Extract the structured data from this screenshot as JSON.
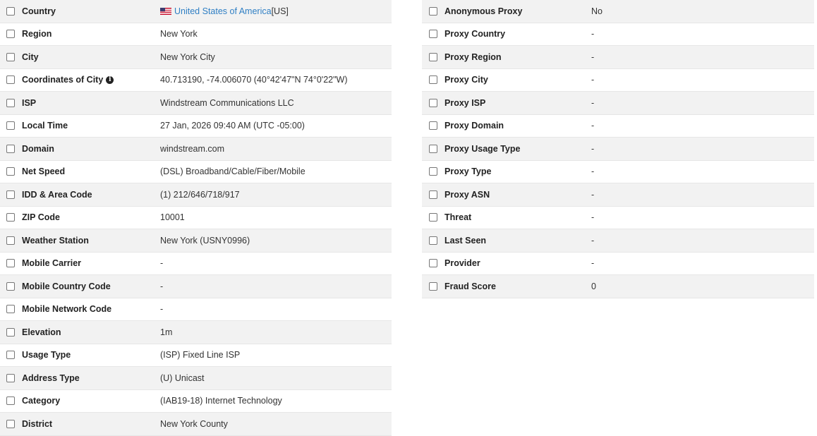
{
  "left": [
    {
      "key": "country",
      "label": "Country",
      "value": "United States of America",
      "suffix": " [US]",
      "flag": "us-flag-icon"
    },
    {
      "key": "region",
      "label": "Region",
      "value": "New York"
    },
    {
      "key": "city",
      "label": "City",
      "value": "New York City"
    },
    {
      "key": "coordinates",
      "label": "Coordinates of City",
      "value": "40.713190, -74.006070 (40°42'47\"N   74°0'22\"W)",
      "info": "info-icon"
    },
    {
      "key": "isp",
      "label": "ISP",
      "value": "Windstream Communications LLC"
    },
    {
      "key": "local-time",
      "label": "Local Time",
      "value": "27 Jan, 2026 09:40 AM (UTC -05:00)"
    },
    {
      "key": "domain",
      "label": "Domain",
      "value": "windstream.com"
    },
    {
      "key": "net-speed",
      "label": "Net Speed",
      "value": "(DSL) Broadband/Cable/Fiber/Mobile"
    },
    {
      "key": "idd-area-code",
      "label": "IDD & Area Code",
      "value": "(1) 212/646/718/917"
    },
    {
      "key": "zip-code",
      "label": "ZIP Code",
      "value": "10001"
    },
    {
      "key": "weather-station",
      "label": "Weather Station",
      "value": "New York (USNY0996)"
    },
    {
      "key": "mobile-carrier",
      "label": "Mobile Carrier",
      "value": "-"
    },
    {
      "key": "mobile-country-code",
      "label": "Mobile Country Code",
      "value": "-"
    },
    {
      "key": "mobile-network-code",
      "label": "Mobile Network Code",
      "value": "-"
    },
    {
      "key": "elevation",
      "label": "Elevation",
      "value": "1m"
    },
    {
      "key": "usage-type",
      "label": "Usage Type",
      "value": "(ISP) Fixed Line ISP"
    },
    {
      "key": "address-type",
      "label": "Address Type",
      "value": "(U) Unicast"
    },
    {
      "key": "category",
      "label": "Category",
      "value": "(IAB19-18) Internet Technology"
    },
    {
      "key": "district",
      "label": "District",
      "value": "New York County"
    }
  ],
  "right": [
    {
      "key": "anonymous-proxy",
      "label": "Anonymous Proxy",
      "value": "No"
    },
    {
      "key": "proxy-country",
      "label": "Proxy Country",
      "value": "-"
    },
    {
      "key": "proxy-region",
      "label": "Proxy Region",
      "value": "-"
    },
    {
      "key": "proxy-city",
      "label": "Proxy City",
      "value": "-"
    },
    {
      "key": "proxy-isp",
      "label": "Proxy ISP",
      "value": "-"
    },
    {
      "key": "proxy-domain",
      "label": "Proxy Domain",
      "value": "-"
    },
    {
      "key": "proxy-usage-type",
      "label": "Proxy Usage Type",
      "value": "-"
    },
    {
      "key": "proxy-type",
      "label": "Proxy Type",
      "value": "-"
    },
    {
      "key": "proxy-asn",
      "label": "Proxy ASN",
      "value": "-"
    },
    {
      "key": "threat",
      "label": "Threat",
      "value": "-"
    },
    {
      "key": "last-seen",
      "label": "Last Seen",
      "value": "-"
    },
    {
      "key": "provider",
      "label": "Provider",
      "value": "-"
    },
    {
      "key": "fraud-score",
      "label": "Fraud Score",
      "value": "0"
    }
  ],
  "colors": {
    "link": "#2f7fc4",
    "stripe": "#f2f2f2"
  }
}
